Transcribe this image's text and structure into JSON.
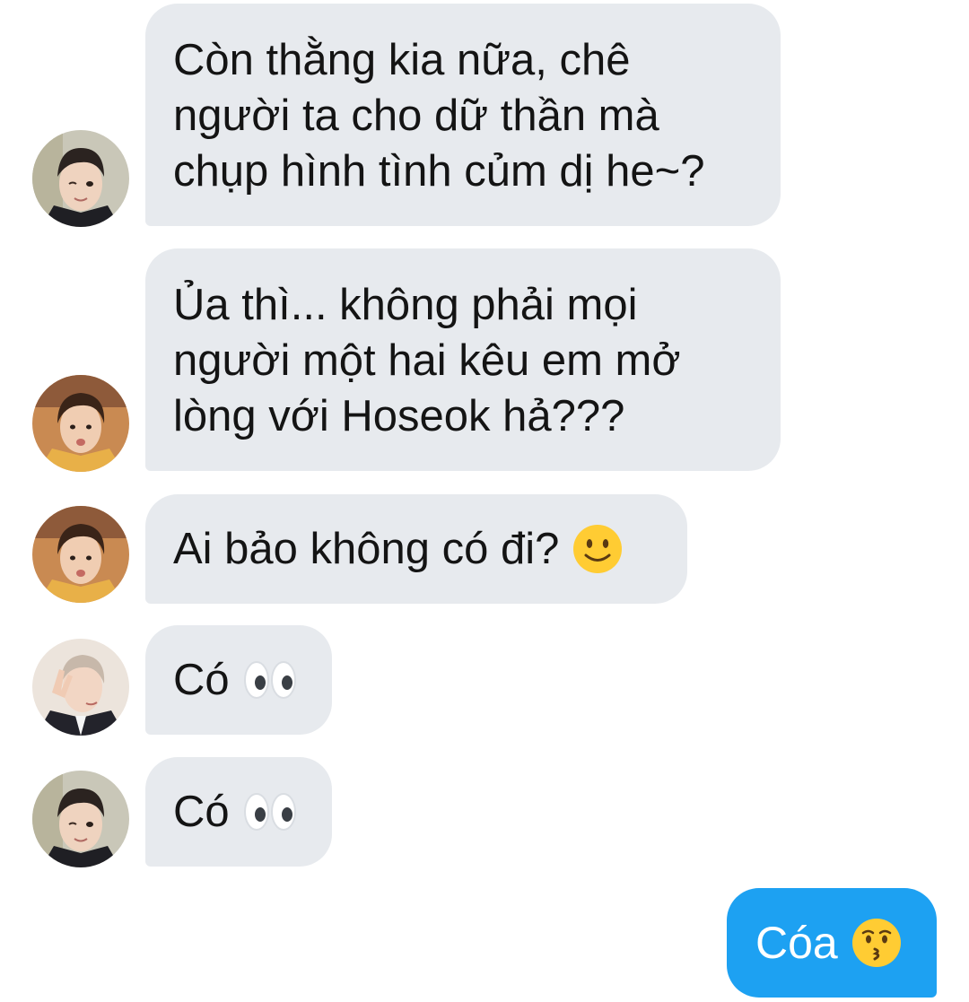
{
  "conversation": {
    "messages": [
      {
        "direction": "incoming",
        "sender_avatar": "avatar-jin-wink",
        "lines": [
          "Còn thằng kia nữa, chê",
          "người ta cho dữ thần mà",
          "chụp hình tình củm dị he~?"
        ]
      },
      {
        "direction": "incoming",
        "sender_avatar": "avatar-v-pout",
        "lines": [
          "Ủa thì... không phải mọi",
          "người một hai kêu em mở",
          "lòng với Hoseok hả???"
        ]
      },
      {
        "direction": "incoming",
        "sender_avatar": "avatar-v-pout",
        "text": "Ai bảo không có đi?",
        "emoji": "slightly-smiling-face-emoji"
      },
      {
        "direction": "incoming",
        "sender_avatar": "avatar-rm-peace",
        "text": "Có",
        "emoji": "eyes-emoji"
      },
      {
        "direction": "incoming",
        "sender_avatar": "avatar-jin-wink",
        "text": "Có",
        "emoji": "eyes-emoji"
      },
      {
        "direction": "outgoing",
        "text": "Cóa",
        "emoji": "kissing-face-emoji"
      }
    ]
  },
  "colors": {
    "incoming_bubble": "#e7eaee",
    "outgoing_bubble": "#1da1f2",
    "incoming_text": "#141414",
    "outgoing_text": "#ffffff"
  }
}
